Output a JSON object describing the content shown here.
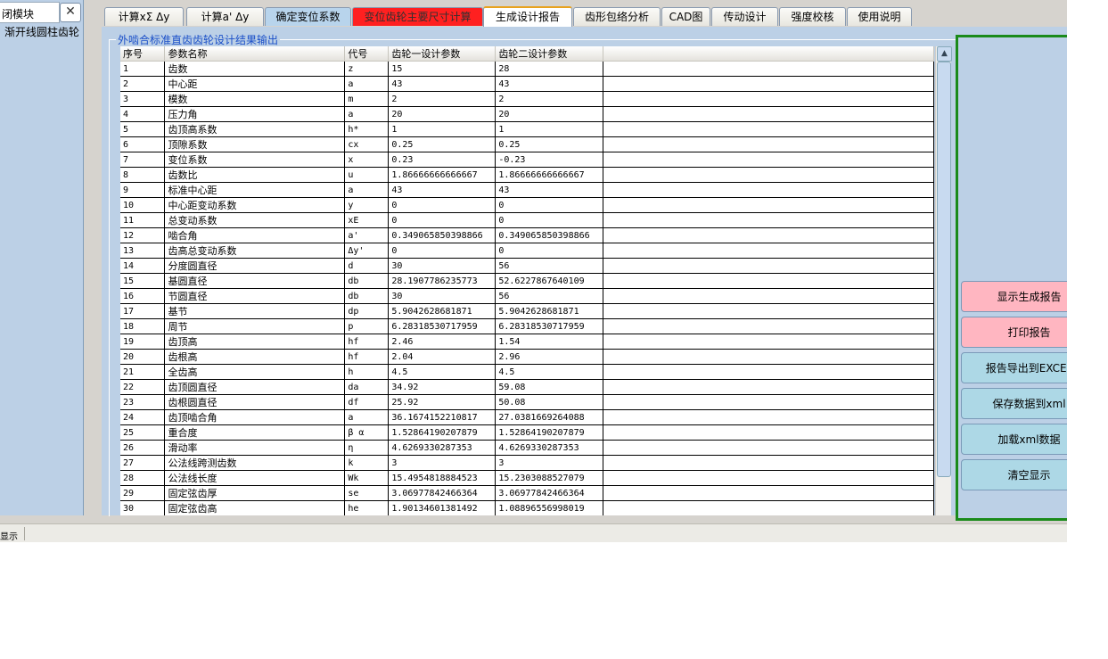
{
  "left_panel": {
    "tab_label": "闭模块",
    "close_label": "✕",
    "tree_item": "渐开线圆柱齿轮"
  },
  "tabs": [
    {
      "label": "计算xΣ Δy",
      "style": "normal"
    },
    {
      "label": "计算a' Δy",
      "style": "normal"
    },
    {
      "label": "确定变位系数",
      "style": "blue"
    },
    {
      "label": "变位齿轮主要尺寸计算",
      "style": "red"
    },
    {
      "label": "生成设计报告",
      "style": "active"
    },
    {
      "label": "齿形包络分析",
      "style": "normal"
    },
    {
      "label": "CAD图",
      "style": "normal"
    },
    {
      "label": "传动设计",
      "style": "normal"
    },
    {
      "label": "强度校核",
      "style": "normal"
    },
    {
      "label": "使用说明",
      "style": "normal"
    }
  ],
  "group_title": "外啮合标准直齿齿轮设计结果输出",
  "table": {
    "headers": [
      "序号",
      "参数名称",
      "代号",
      "齿轮一设计参数",
      "齿轮二设计参数",
      ""
    ],
    "rows": [
      [
        "1",
        "齿数",
        "z",
        "15",
        "28"
      ],
      [
        "2",
        "中心距",
        "a",
        "43",
        "43"
      ],
      [
        "3",
        "模数",
        "m",
        "2",
        "2"
      ],
      [
        "4",
        "压力角",
        "a",
        "20",
        "20"
      ],
      [
        "5",
        "齿顶高系数",
        "h*",
        "1",
        "1"
      ],
      [
        "6",
        "顶隙系数",
        "cx",
        "0.25",
        "0.25"
      ],
      [
        "7",
        "变位系数",
        "x",
        "0.23",
        "-0.23"
      ],
      [
        "8",
        "齿数比",
        "u",
        "1.86666666666667",
        "1.86666666666667"
      ],
      [
        "9",
        "标准中心距",
        "a",
        "43",
        "43"
      ],
      [
        "10",
        "中心距变动系数",
        "y",
        "0",
        "0"
      ],
      [
        "11",
        "总变动系数",
        "xE",
        "0",
        "0"
      ],
      [
        "12",
        "啮合角",
        "a'",
        "0.349065850398866",
        "0.349065850398866"
      ],
      [
        "13",
        "齿高总变动系数",
        "Δy'",
        "0",
        "0"
      ],
      [
        "14",
        "分度圆直径",
        "d",
        "30",
        "56"
      ],
      [
        "15",
        "基圆直径",
        "db",
        "28.1907786235773",
        "52.6227867640109"
      ],
      [
        "16",
        "节圆直径",
        "db",
        "30",
        "56"
      ],
      [
        "17",
        "基节",
        "dp",
        "5.9042628681871",
        "5.9042628681871"
      ],
      [
        "18",
        "周节",
        "p",
        "6.28318530717959",
        "6.28318530717959"
      ],
      [
        "19",
        "齿顶高",
        "hf",
        "2.46",
        "1.54"
      ],
      [
        "20",
        "齿根高",
        "hf",
        "2.04",
        "2.96"
      ],
      [
        "21",
        "全齿高",
        "h",
        "4.5",
        "4.5"
      ],
      [
        "22",
        "齿顶圆直径",
        "da",
        "34.92",
        "59.08"
      ],
      [
        "23",
        "齿根圆直径",
        "df",
        "25.92",
        "50.08"
      ],
      [
        "24",
        "齿顶啮合角",
        "a",
        "36.1674152210817",
        "27.0381669264088"
      ],
      [
        "25",
        "重合度",
        "β α",
        "1.52864190207879",
        "1.52864190207879"
      ],
      [
        "26",
        "滑动率",
        "η",
        "4.6269330287353",
        "4.6269330287353"
      ],
      [
        "27",
        "公法线跨测齿数",
        "k",
        "3",
        "3"
      ],
      [
        "28",
        "公法线长度",
        "Wk",
        "15.4954818884523",
        "15.2303088527079"
      ],
      [
        "29",
        "固定弦齿厚",
        "se",
        "3.06977842466364",
        "3.06977842466364"
      ],
      [
        "30",
        "固定弦齿高",
        "he",
        "1.90134601381492",
        "1.08896556998019"
      ]
    ]
  },
  "right_buttons": [
    {
      "label": "显示生成报告",
      "color": "pink"
    },
    {
      "label": "打印报告",
      "color": "pink"
    },
    {
      "label": "报告导出到EXCEL",
      "color": "blue"
    },
    {
      "label": "保存数据到xml",
      "color": "blue"
    },
    {
      "label": "加载xml数据",
      "color": "blue"
    },
    {
      "label": "清空显示",
      "color": "blue"
    }
  ],
  "statusbar": {
    "text": "显示"
  },
  "colors": {
    "panel_bg": "#bcd0e6",
    "preview_border": "#1a8a1a",
    "pink_button": "#ffb6c1",
    "blue_button": "#add8e6",
    "active_tab_top": "#e8a21e",
    "red_tab": "#ff2020"
  }
}
